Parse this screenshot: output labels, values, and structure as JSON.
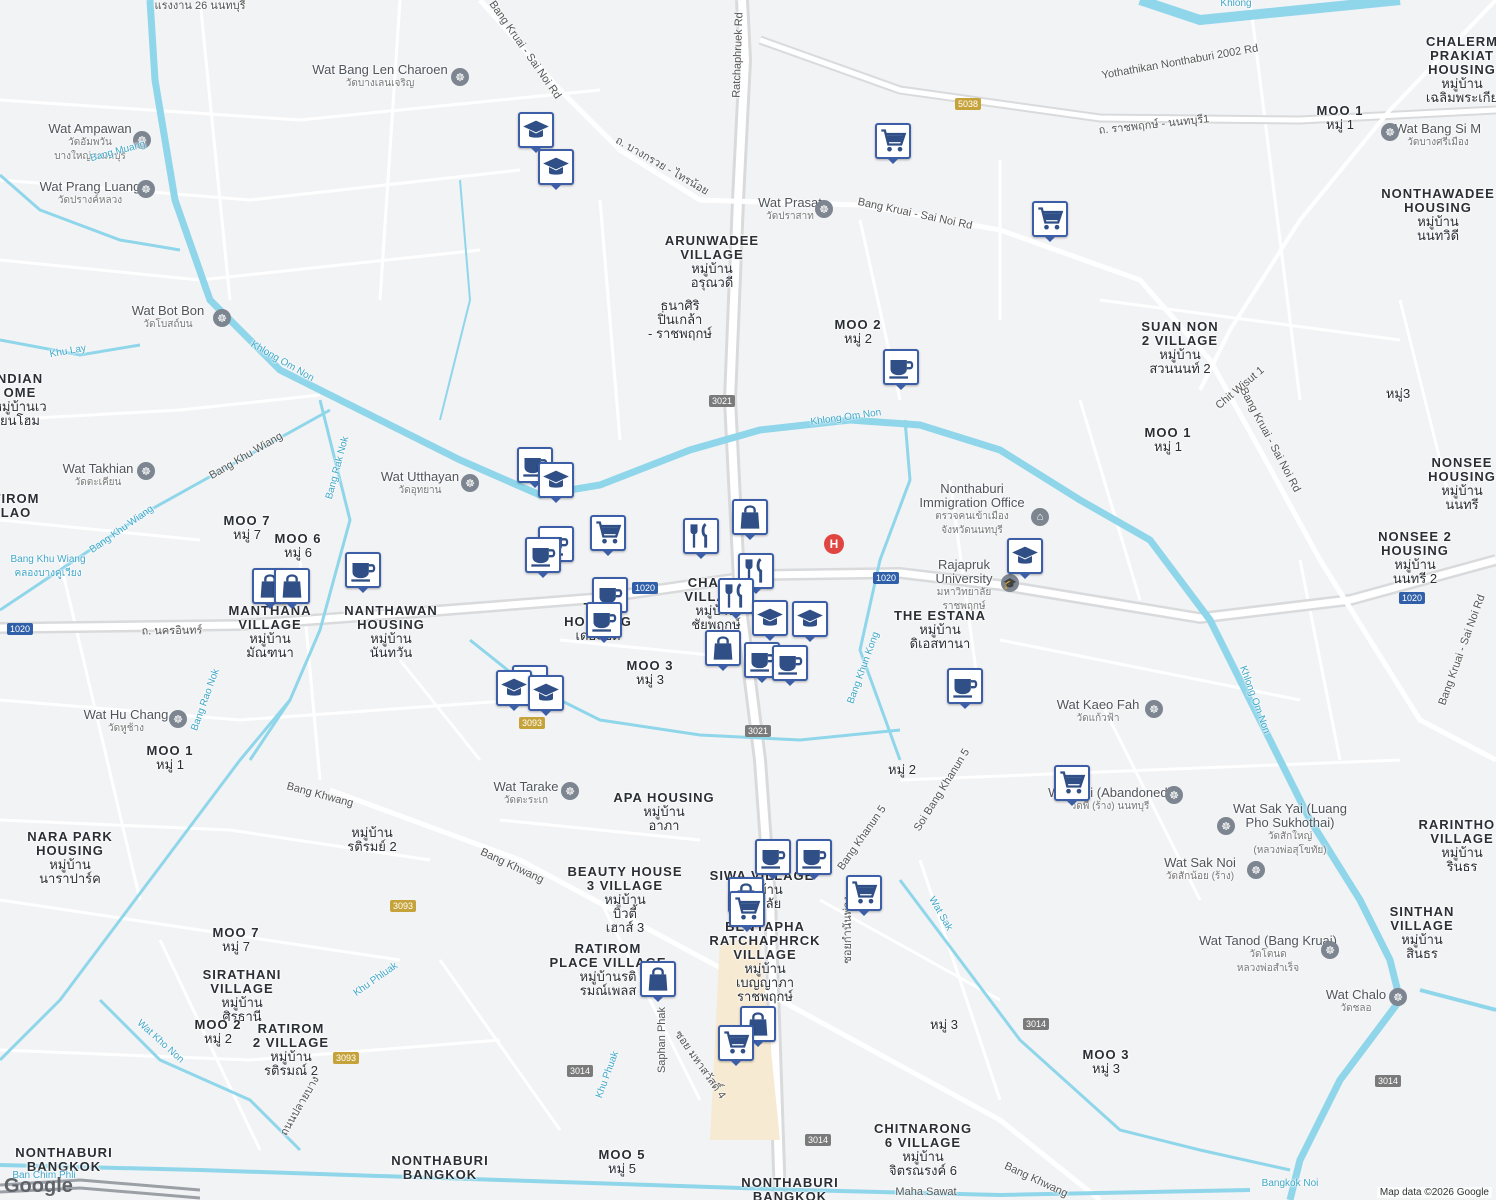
{
  "map": {
    "attribution": "Map data ©2026 Google",
    "logo": "Google",
    "colors": {
      "land": "#f2f3f5",
      "water": "#8fd6ea",
      "road": "#ffffff",
      "major_road": "#d9dadc",
      "pin_border": "#3b5ea6",
      "pin_icon": "#2f4f86"
    },
    "areas": [
      {
        "id": "arunwadee",
        "en": "ARUNWADEE\nVILLAGE",
        "th": "หมู่บ้าน\nอรุณวดี"
      },
      {
        "id": "thanasiri",
        "en": "",
        "th": "ธนาศิริ\nปิ่นเกล้า\n- ราชพฤกษ์"
      },
      {
        "id": "moo2_top",
        "en": "MOO 2",
        "th": "หมู่ 2"
      },
      {
        "id": "nonthawadee",
        "en": "NONTHAWADEE\nHOUSING",
        "th": "หมู่บ้าน\nนนทวิดี"
      },
      {
        "id": "suannon",
        "en": "SUAN NON\n2 VILLAGE",
        "th": "หมู่บ้าน\nสวนนนท์ 2"
      },
      {
        "id": "moo3_right",
        "en": "",
        "th": "หมู่3"
      },
      {
        "id": "moo1_right",
        "en": "MOO 1",
        "th": "หมู่ 1"
      },
      {
        "id": "nonsee",
        "en": "NONSEE\nHOUSING",
        "th": "หมู่บ้าน\nนนทรี"
      },
      {
        "id": "nonsee2",
        "en": "NONSEE 2\nHOUSING",
        "th": "หมู่บ้าน\nนนทรี 2"
      },
      {
        "id": "chalerm",
        "en": "CHALERM\nPRAKIAT\nHOUSING",
        "th": "หมู่บ้าน\nเฉลิมพระเกีย"
      },
      {
        "id": "moo1_topright",
        "en": "MOO 1",
        "th": "หมู่ 1"
      },
      {
        "id": "moo7",
        "en": "MOO 7",
        "th": "หมู่ 7"
      },
      {
        "id": "moo6",
        "en": "MOO 6",
        "th": "หมู่ 6"
      },
      {
        "id": "manthana",
        "en": "MANTHANA\nVILLAGE",
        "th": "หมู่บ้าน\nมัณฑนา"
      },
      {
        "id": "nanthawan",
        "en": "NANTHAWAN\nHOUSING",
        "th": "หมู่บ้าน\nนันทวัน"
      },
      {
        "id": "the_housing",
        "en": "THE\nHOUSING",
        "th": "เดอะซิตี้"
      },
      {
        "id": "chaiyo",
        "en": "CHAIYO\nVILLAGE",
        "th": "หมู่บ้าน\nชัยพฤกษ์"
      },
      {
        "id": "moo3_mid",
        "en": "MOO 3",
        "th": "หมู่ 3"
      },
      {
        "id": "the_estana",
        "en": "THE ESTANA",
        "th": "หมู่บ้าน\nดิเอสทานา"
      },
      {
        "id": "moo1_left",
        "en": "MOO 1",
        "th": "หมู่ 1"
      },
      {
        "id": "nara_park",
        "en": "NARA PARK\nHOUSING",
        "th": "หมู่บ้าน\nนาราปาร์ค"
      },
      {
        "id": "ratirom2_top",
        "en": "",
        "th": "หมู่บ้าน\nรติรมย์ 2"
      },
      {
        "id": "apa",
        "en": "APA HOUSING",
        "th": "หมู่บ้าน\nอาภา"
      },
      {
        "id": "moo2_mid",
        "en": "",
        "th": "หมู่ 2"
      },
      {
        "id": "beauty_house",
        "en": "BEAUTY HOUSE\n3 VILLAGE",
        "th": "หมู่บ้าน\nบิวตี้\nเฮาส์ 3"
      },
      {
        "id": "siwa",
        "en": "SIWA VILLAGE",
        "th": "หมู่บ้าน\nศิวาลัย"
      },
      {
        "id": "benyapha",
        "en": "BENYAPHA\nRATCHAPHRCK\nVILLAGE",
        "th": "หมู่บ้าน\nเบญญาภา\nราชพฤกษ์"
      },
      {
        "id": "ratirom_place",
        "en": "RATIROM\nPLACE VILLAGE",
        "th": "หมู่บ้านรติ\nรมณ์เพลส"
      },
      {
        "id": "moo7_left",
        "en": "MOO 7",
        "th": "หมู่ 7"
      },
      {
        "id": "sirathani",
        "en": "SIRATHANI\nVILLAGE",
        "th": "หมู่บ้าน\nศิรธานี"
      },
      {
        "id": "moo2_left",
        "en": "MOO 2",
        "th": "หมู่ 2"
      },
      {
        "id": "ratirom2",
        "en": "RATIROM\n2 VILLAGE",
        "th": "หมู่บ้าน\nรติรมณ์ 2"
      },
      {
        "id": "moo3_bottom",
        "en": "",
        "th": "หมู่ 3"
      },
      {
        "id": "moo3_br",
        "en": "MOO 3",
        "th": "หมู่ 3"
      },
      {
        "id": "chitnarong",
        "en": "CHITNARONG\n6 VILLAGE",
        "th": "หมู่บ้าน\nจิตรณรงค์ 6"
      },
      {
        "id": "moo5",
        "en": "MOO 5",
        "th": "หมู่ 5"
      },
      {
        "id": "rarinthorn",
        "en": "RARINTHOR\nVILLAGE",
        "th": "หมู่บ้าน\nรินธร"
      },
      {
        "id": "sinthan",
        "en": "SINTHAN\nVILLAGE",
        "th": "หมู่บ้าน\nสินธร"
      },
      {
        "id": "nonthaburi_bkk_left",
        "en": "NONTHABURI\nBANGKOK",
        "th": ""
      },
      {
        "id": "nonthaburi_bkk_mid",
        "en": "NONTHABURI\nBANGKOK",
        "th": ""
      },
      {
        "id": "nonthaburi_bkk_bottom",
        "en": "NONTHABURI\nBANGKOK",
        "th": ""
      },
      {
        "id": "indian_home",
        "en": "NDIAN\nOME",
        "th": "หมู่บ้านเว\nยนโฮม"
      },
      {
        "id": "tirom",
        "en": "TIROM\nLAO",
        "th": ""
      }
    ],
    "wats": [
      {
        "id": "bang_len",
        "en": "Wat Bang Len Charoen",
        "th": "วัดบางเลนเจริญ"
      },
      {
        "id": "ampawan",
        "en": "Wat Ampawan",
        "th": "วัดอัมพวัน\nบางใหญ่ นนทบุรี"
      },
      {
        "id": "prang_luang",
        "en": "Wat Prang Luang",
        "th": "วัดปรางค์หลวง"
      },
      {
        "id": "bot_bon",
        "en": "Wat Bot Bon",
        "th": "วัดโบสถ์บน"
      },
      {
        "id": "takhian",
        "en": "Wat Takhian",
        "th": "วัดตะเคียน"
      },
      {
        "id": "utthayan",
        "en": "Wat Utthayan",
        "th": "วัดอุทยาน"
      },
      {
        "id": "prasat",
        "en": "Wat Prasat",
        "th": "วัดปราสาท"
      },
      {
        "id": "bang_si_mueang",
        "en": "Wat Bang Si M",
        "th": "วัดบางศรีเมือง"
      },
      {
        "id": "hu_chang",
        "en": "Wat Hu Chang",
        "th": "วัดหูช้าง"
      },
      {
        "id": "tarake",
        "en": "Wat Tarake",
        "th": "วัดตะระเก"
      },
      {
        "id": "kaeo_fah",
        "en": "Wat Kaeo Fah",
        "th": "วัดแก้วฟ้า"
      },
      {
        "id": "phi",
        "en": "Wat Phi (Abandoned)",
        "th": "วัดพี (ร้าง) นนทบุรี"
      },
      {
        "id": "sak_yai",
        "en": "Wat Sak Yai (Luang\nPho Sukhothai)",
        "th": "วัดสักใหญ่\n(หลวงพ่อสุโขทัย)"
      },
      {
        "id": "sak_noi",
        "en": "Wat Sak Noi",
        "th": "วัดสักน้อย (ร้าง)"
      },
      {
        "id": "tanod",
        "en": "Wat Tanod (Bang Kruai)",
        "th": "วัดโตนด\nหลวงพ่อสำเร็จ"
      },
      {
        "id": "chalo",
        "en": "Wat Chalo",
        "th": "วัดชลอ"
      }
    ],
    "pois": [
      {
        "id": "immigration",
        "en": "Nonthaburi\nImmigration Office",
        "th": "ตรวจคนเข้าเมือง\nจังหวัดนนทบุรี"
      },
      {
        "id": "rajapruk",
        "en": "Rajapruk\nUniversity",
        "th": "มหาวิทยาลัย\nราชพฤกษ์"
      }
    ],
    "roads": [
      {
        "id": "bang_kruai_sai_noi_top",
        "name": "Bang Kruai - Sai Noi Rd"
      },
      {
        "id": "bang_kruai_thai_noi",
        "name": "ถ. บางกรวย - ไทรน้อย"
      },
      {
        "id": "bang_kruai_sai_noi_mid",
        "name": "Bang Kruai - Sai Noi Rd"
      },
      {
        "id": "ratchaphruek",
        "name": "Ratchaphruek Rd"
      },
      {
        "id": "ratchaphruek_nonthaburi1",
        "name": "ถ. ราชพฤกษ์ - นนทบุรี1"
      },
      {
        "id": "yothathikan",
        "name": "Yothathikan Nonthaburi 2002 Rd"
      },
      {
        "id": "nakhon_in",
        "name": "ถ. นครอินทร์"
      },
      {
        "id": "bang_kruai_sai_noi_right",
        "name": "Bang Kruai - Sai Noi Rd"
      },
      {
        "id": "bang_kruai_sai_noi_far",
        "name": "Bang Kruai - Sai Noi Rd"
      },
      {
        "id": "chit_wisut",
        "name": "Chit Wisut 1"
      },
      {
        "id": "bang_khwang_left",
        "name": "Bang Khwang"
      },
      {
        "id": "bang_khwang_mid",
        "name": "Bang Khwang"
      },
      {
        "id": "bang_khwang_bottom",
        "name": "Bang Khwang"
      },
      {
        "id": "bang_khanun5",
        "name": "Bang Khanun 5"
      },
      {
        "id": "soi_bang_khanun5",
        "name": "Soi Bang Khanun 5"
      },
      {
        "id": "maha_sawat",
        "name": "Maha Sawat"
      },
      {
        "id": "saphan_phak",
        "name": "Saphan Phak"
      },
      {
        "id": "soi_maha_sawat4",
        "name": "ซอย มหาสวัสดิ์ 4"
      },
      {
        "id": "thanon_plai_bang",
        "name": "ถนนปลายบาง"
      },
      {
        "id": "soi_kamnan",
        "name": "ซอยกำนันพ่วง"
      },
      {
        "id": "rang_ngan",
        "name": "แรงงาน 26 นนทบุรี"
      },
      {
        "id": "bang_khu_wiang_road",
        "name": "Bang Khu Wiang"
      }
    ],
    "waterways": [
      {
        "id": "khlong_om_non_left",
        "name": "Khlong Om Non"
      },
      {
        "id": "khlong_om_non_mid",
        "name": "Khlong Om Non"
      },
      {
        "id": "khlong_om_non_right",
        "name": "Khlong Om Non"
      },
      {
        "id": "bang_muang",
        "name": "Bang Muang"
      },
      {
        "id": "khu_lay",
        "name": "Khu Lay"
      },
      {
        "id": "bang_khu_wiang",
        "name": "Bang Khu Wiang"
      },
      {
        "id": "bang_khu_wiang_th",
        "name": "Bang Khu Wiang\nคลองบางคูเวียง"
      },
      {
        "id": "bang_rak_nok",
        "name": "Bang Rak Nok"
      },
      {
        "id": "bang_rao_nok_left",
        "name": "Bang Rao Nok"
      },
      {
        "id": "bang_khun_kong",
        "name": "Bang Khun Kong"
      },
      {
        "id": "wat_kho_non",
        "name": "Wat Kho Non"
      },
      {
        "id": "khu_phluak",
        "name": "Khu Phluak"
      },
      {
        "id": "wat_sak",
        "name": "Wat Sak"
      },
      {
        "id": "bangkok_noi",
        "name": "Bangkok Noi"
      },
      {
        "id": "khlong",
        "name": "Khlong"
      },
      {
        "id": "khu_phuak",
        "name": "Khu Phuak"
      },
      {
        "id": "ban_chim_phli",
        "name": "Ban Chim Phli"
      }
    ],
    "shields": [
      {
        "id": "s5038",
        "text": "5038",
        "style": "gold"
      },
      {
        "id": "s3021a",
        "text": "3021",
        "style": "gray"
      },
      {
        "id": "s1020a",
        "text": "1020",
        "style": "blue"
      },
      {
        "id": "s1020b",
        "text": "1020",
        "style": "blue"
      },
      {
        "id": "s1020c",
        "text": "1020",
        "style": "blue"
      },
      {
        "id": "s1020d",
        "text": "1020",
        "style": "blue"
      },
      {
        "id": "s3021b",
        "text": "3021",
        "style": "gray"
      },
      {
        "id": "s3093a",
        "text": "3093",
        "style": "gold"
      },
      {
        "id": "s3093b",
        "text": "3093",
        "style": "gold"
      },
      {
        "id": "s3093c",
        "text": "3093",
        "style": "gold"
      },
      {
        "id": "s3014a",
        "text": "3014",
        "style": "gray"
      },
      {
        "id": "s3014b",
        "text": "3014",
        "style": "gray"
      },
      {
        "id": "s3014c",
        "text": "3014",
        "style": "gray"
      },
      {
        "id": "s3014d",
        "text": "3014",
        "style": "gray"
      }
    ],
    "markers": [
      {
        "id": "m1",
        "type": "school"
      },
      {
        "id": "m2",
        "type": "school"
      },
      {
        "id": "m3",
        "type": "shop-cart"
      },
      {
        "id": "m4",
        "type": "shop-cart"
      },
      {
        "id": "m5",
        "type": "cafe"
      },
      {
        "id": "m6",
        "type": "cafe"
      },
      {
        "id": "m7",
        "type": "school"
      },
      {
        "id": "m8",
        "type": "cafe"
      },
      {
        "id": "m9",
        "type": "cafe"
      },
      {
        "id": "m10",
        "type": "shop-cart"
      },
      {
        "id": "m11",
        "type": "restaurant"
      },
      {
        "id": "m12",
        "type": "bag"
      },
      {
        "id": "m13",
        "type": "school"
      },
      {
        "id": "m14",
        "type": "bag"
      },
      {
        "id": "m15",
        "type": "bag"
      },
      {
        "id": "m16",
        "type": "cafe"
      },
      {
        "id": "m17",
        "type": "cafe"
      },
      {
        "id": "m18",
        "type": "restaurant"
      },
      {
        "id": "m19",
        "type": "restaurant"
      },
      {
        "id": "m20",
        "type": "cafe"
      },
      {
        "id": "m21",
        "type": "school"
      },
      {
        "id": "m22",
        "type": "school"
      },
      {
        "id": "m23",
        "type": "bag"
      },
      {
        "id": "m24",
        "type": "cafe"
      },
      {
        "id": "m25",
        "type": "cafe"
      },
      {
        "id": "m26",
        "type": "school"
      },
      {
        "id": "m27",
        "type": "school"
      },
      {
        "id": "m28",
        "type": "school"
      },
      {
        "id": "m29",
        "type": "cafe"
      },
      {
        "id": "m30",
        "type": "shop-cart"
      },
      {
        "id": "m31",
        "type": "cafe"
      },
      {
        "id": "m32",
        "type": "cafe"
      },
      {
        "id": "m33",
        "type": "shop-cart"
      },
      {
        "id": "m34",
        "type": "bag"
      },
      {
        "id": "m35",
        "type": "shop-cart"
      },
      {
        "id": "m36",
        "type": "bag"
      },
      {
        "id": "m37",
        "type": "bag"
      },
      {
        "id": "m38",
        "type": "shop-cart"
      }
    ]
  }
}
